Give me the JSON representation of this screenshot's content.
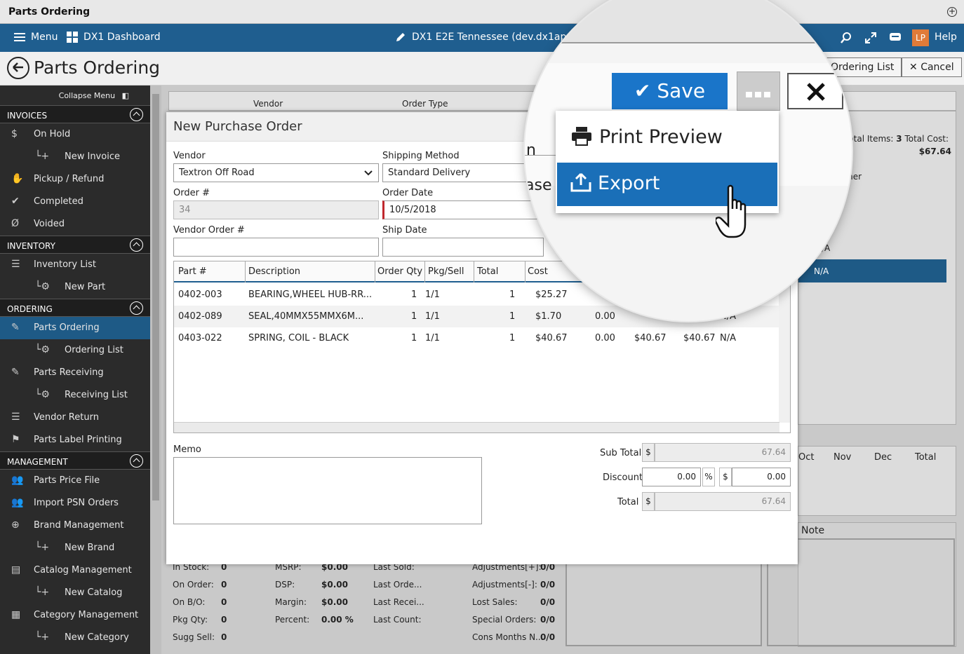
{
  "window": {
    "title": "Parts Ordering"
  },
  "nav": {
    "menu": "Menu",
    "dashboard": "DX1 Dashboard",
    "site": "DX1 E2E Tennessee (dev.dx1app.com)",
    "avatar": "LP",
    "help": "Help"
  },
  "page": {
    "title": "Parts Ordering",
    "ordering_list": "Ordering List",
    "cancel": "Cancel"
  },
  "sidebar": {
    "collapse": "Collapse Menu",
    "sections": [
      {
        "label": "INVOICES",
        "items": [
          {
            "label": "On Hold",
            "icon": "dollar-icon"
          },
          {
            "label": "New Invoice",
            "icon": "plus-icon",
            "sub": true
          },
          {
            "label": "Pickup / Refund",
            "icon": "hand-icon"
          },
          {
            "label": "Completed",
            "icon": "check-icon"
          },
          {
            "label": "Voided",
            "icon": "void-icon"
          }
        ]
      },
      {
        "label": "INVENTORY",
        "items": [
          {
            "label": "Inventory List",
            "icon": "list-icon"
          },
          {
            "label": "New Part",
            "icon": "gear-plus-icon",
            "sub": true
          }
        ]
      },
      {
        "label": "ORDERING",
        "items": [
          {
            "label": "Parts Ordering",
            "icon": "edit-icon",
            "active": true
          },
          {
            "label": "Ordering List",
            "icon": "gear-plus-icon",
            "sub": true
          },
          {
            "label": "Parts Receiving",
            "icon": "edit-icon"
          },
          {
            "label": "Receiving List",
            "icon": "gear-plus-icon",
            "sub": true
          },
          {
            "label": "Vendor Return",
            "icon": "list-icon"
          },
          {
            "label": "Parts Label Printing",
            "icon": "tag-icon"
          }
        ]
      },
      {
        "label": "MANAGEMENT",
        "items": [
          {
            "label": "Parts Price File",
            "icon": "users-icon"
          },
          {
            "label": "Import PSN Orders",
            "icon": "users-icon"
          },
          {
            "label": "Brand Management",
            "icon": "globe-icon"
          },
          {
            "label": "New Brand",
            "icon": "plus-icon",
            "sub": true
          },
          {
            "label": "Catalog Management",
            "icon": "book-icon"
          },
          {
            "label": "New Catalog",
            "icon": "plus-icon",
            "sub": true
          },
          {
            "label": "Category Management",
            "icon": "grid-icon"
          },
          {
            "label": "New Category",
            "icon": "plus-icon",
            "sub": true
          }
        ]
      }
    ]
  },
  "background": {
    "vendor_header": "Vendor",
    "order_type_header": "Order Type",
    "total_items_label": "Total Items:",
    "total_items": "3",
    "total_cost_label": "Total Cost:",
    "total_cost": "$67.64",
    "customer_col": "mer",
    "na1": "N/A",
    "na2": "N/A",
    "na_prefix": "0",
    "months": [
      "Oct",
      "Nov",
      "Dec",
      "Total"
    ],
    "note": "Note",
    "stats1": [
      [
        "In Stock:",
        "0"
      ],
      [
        "On Order:",
        "0"
      ],
      [
        "On B/O:",
        "0"
      ],
      [
        "Pkg Qty:",
        "0"
      ],
      [
        "Sugg Sell:",
        "0"
      ]
    ],
    "stats2": [
      [
        "MSRP:",
        "$0.00"
      ],
      [
        "DSP:",
        "$0.00"
      ],
      [
        "Margin:",
        "$0.00"
      ],
      [
        "Percent:",
        "0.00 %"
      ]
    ],
    "stats3": [
      [
        "Last Sold:"
      ],
      [
        "Last Orde..."
      ],
      [
        "Last Recei..."
      ],
      [
        "Last Count:"
      ]
    ],
    "stats4": [
      [
        "Adjustments[+]:",
        "0/0"
      ],
      [
        "Adjustments[-]:",
        "0/0"
      ],
      [
        "Lost Sales:",
        "0/0"
      ],
      [
        "Special Orders:",
        "0/0"
      ],
      [
        "Cons Months N...",
        "0/0"
      ]
    ]
  },
  "modal": {
    "title": "New Purchase Order",
    "vendor_label": "Vendor",
    "vendor_value": "Textron Off Road",
    "shipping_label": "Shipping Method",
    "shipping_value": "Standard Delivery",
    "order_no_label": "Order #",
    "order_no_value": "34",
    "order_date_label": "Order Date",
    "order_date_value": "10/5/2018",
    "vendor_order_label": "Vendor Order #",
    "ship_date_label": "Ship Date",
    "columns": [
      "Part #",
      "Description",
      "Order Qty",
      "Pkg/Sell",
      "Total",
      "Cost"
    ],
    "rows": [
      {
        "part": "0402-003",
        "desc": "BEARING,WHEEL HUB-RR...",
        "qty": "1",
        "pkg": "1/1",
        "total": "1",
        "cost": "$25.27",
        "c7": "",
        "c8": "",
        "c9": "",
        "c10": ""
      },
      {
        "part": "0402-089",
        "desc": "SEAL,40MMX55MMX6M...",
        "qty": "1",
        "pkg": "1/1",
        "total": "1",
        "cost": "$1.70",
        "c7": "0.00",
        "c8": "",
        "c9": "",
        "c10": "N/A"
      },
      {
        "part": "0403-022",
        "desc": "SPRING, COIL - BLACK",
        "qty": "1",
        "pkg": "1/1",
        "total": "1",
        "cost": "$40.67",
        "c7": "0.00",
        "c8": "$40.67",
        "c9": "$40.67",
        "c10": "N/A"
      }
    ],
    "memo_label": "Memo",
    "subtotal_label": "Sub Total",
    "subtotal": "67.64",
    "discount_label": "Discount",
    "discount_pct": "0.00",
    "discount_amt": "0.00",
    "total_label": "Total",
    "total": "67.64",
    "currency": "$",
    "pct": "%"
  },
  "magnifier": {
    "save": "Save",
    "print_preview": "Print Preview",
    "export": "Export",
    "clip1": "n",
    "clip2": "ase"
  },
  "colors": {
    "nav": "#1f5e8f",
    "save": "#1a75c9",
    "export": "#1a6fb8"
  }
}
